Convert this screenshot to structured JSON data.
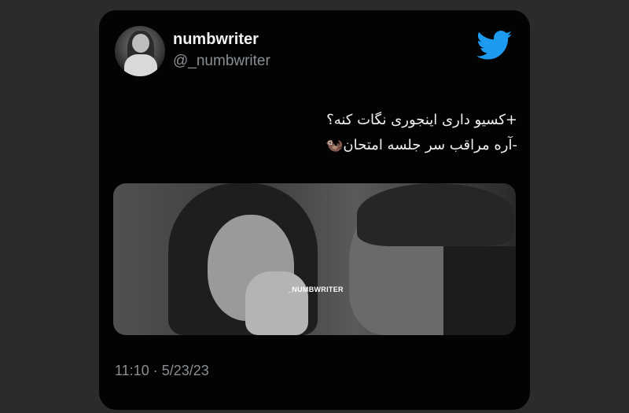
{
  "tweet": {
    "display_name": "numbwriter",
    "handle": "@_numbwriter",
    "text_lines": [
      "+کسیو داری اینجوری نگات کنه؟",
      "-آره مراقب سر جلسه امتحان🦦"
    ],
    "media_watermark": "_NUMBWRITER",
    "timestamp": "11:10 · 5/23/23"
  },
  "icons": {
    "brand": "twitter-bird-icon"
  },
  "colors": {
    "card_background": "#030303",
    "twitter_blue": "#1d9bf0",
    "secondary_text": "#8a8f94"
  }
}
